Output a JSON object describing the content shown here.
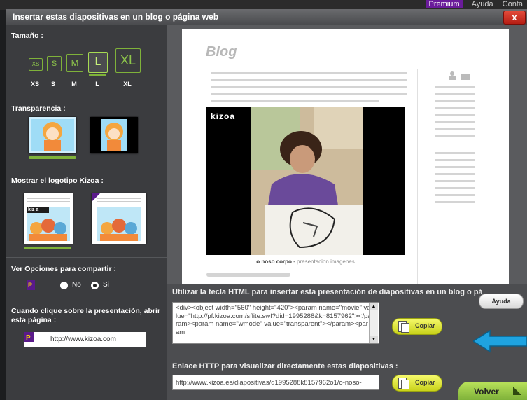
{
  "site": {
    "links": [
      "Premium",
      "Ayuda",
      "Conta"
    ]
  },
  "dialog": {
    "title": "Insertar estas diapositivas en un blog o página web",
    "close_label": "x"
  },
  "tamano": {
    "title": "Tamaño :",
    "options": [
      {
        "box": "XS",
        "label": "XS"
      },
      {
        "box": "S",
        "label": "S"
      },
      {
        "box": "M",
        "label": "M"
      },
      {
        "box": "L",
        "label": "L"
      },
      {
        "box": "XL",
        "label": "XL"
      }
    ],
    "selected": "L"
  },
  "transparencia": {
    "title": "Transparencia :"
  },
  "logotipo": {
    "title": "Mostrar el logotipo Kizoa :",
    "logo_text": "kiz a"
  },
  "compartir": {
    "title": "Ver Opciones para compartir :",
    "no_label": "No",
    "si_label": "Si",
    "selected": "Si"
  },
  "link_section": {
    "title": "Cuando clique sobre la presentación, abrir esta página :",
    "url": "http://www.kizoa.com"
  },
  "preview": {
    "blog_title": "Blog",
    "video_logo": "kizoa",
    "caption_bold": "o noso corpo",
    "caption_sep": " - ",
    "caption_gray": "presentacion imagenes"
  },
  "embed": {
    "label": "Utilizar la tecla HTML para insertar esta presentación de diapositivas en un blog o pá",
    "code": "<div><object width=\"560\" height=\"420\"><param name=\"movie\" value=\"http://pf.kizoa.com/sflite.swf?did=1995288&k=8157962\"></param><param name=\"wmode\" value=\"transparent\"></param><param",
    "copy_label": "Copiar",
    "help_label": "Ayuda"
  },
  "link": {
    "label": "Enlace HTTP para visualizar directamente estas diapositivas :",
    "url": "http://www.kizoa.es/diapositivas/d1995288k8157962o1/o-noso-",
    "copy_label": "Copiar"
  },
  "back_label": "Volver",
  "colors": {
    "accent_green": "#7fb23a",
    "copy_yellow": "#e1e83a",
    "close_red": "#c8281c",
    "arrow_blue": "#1fa3e0"
  }
}
